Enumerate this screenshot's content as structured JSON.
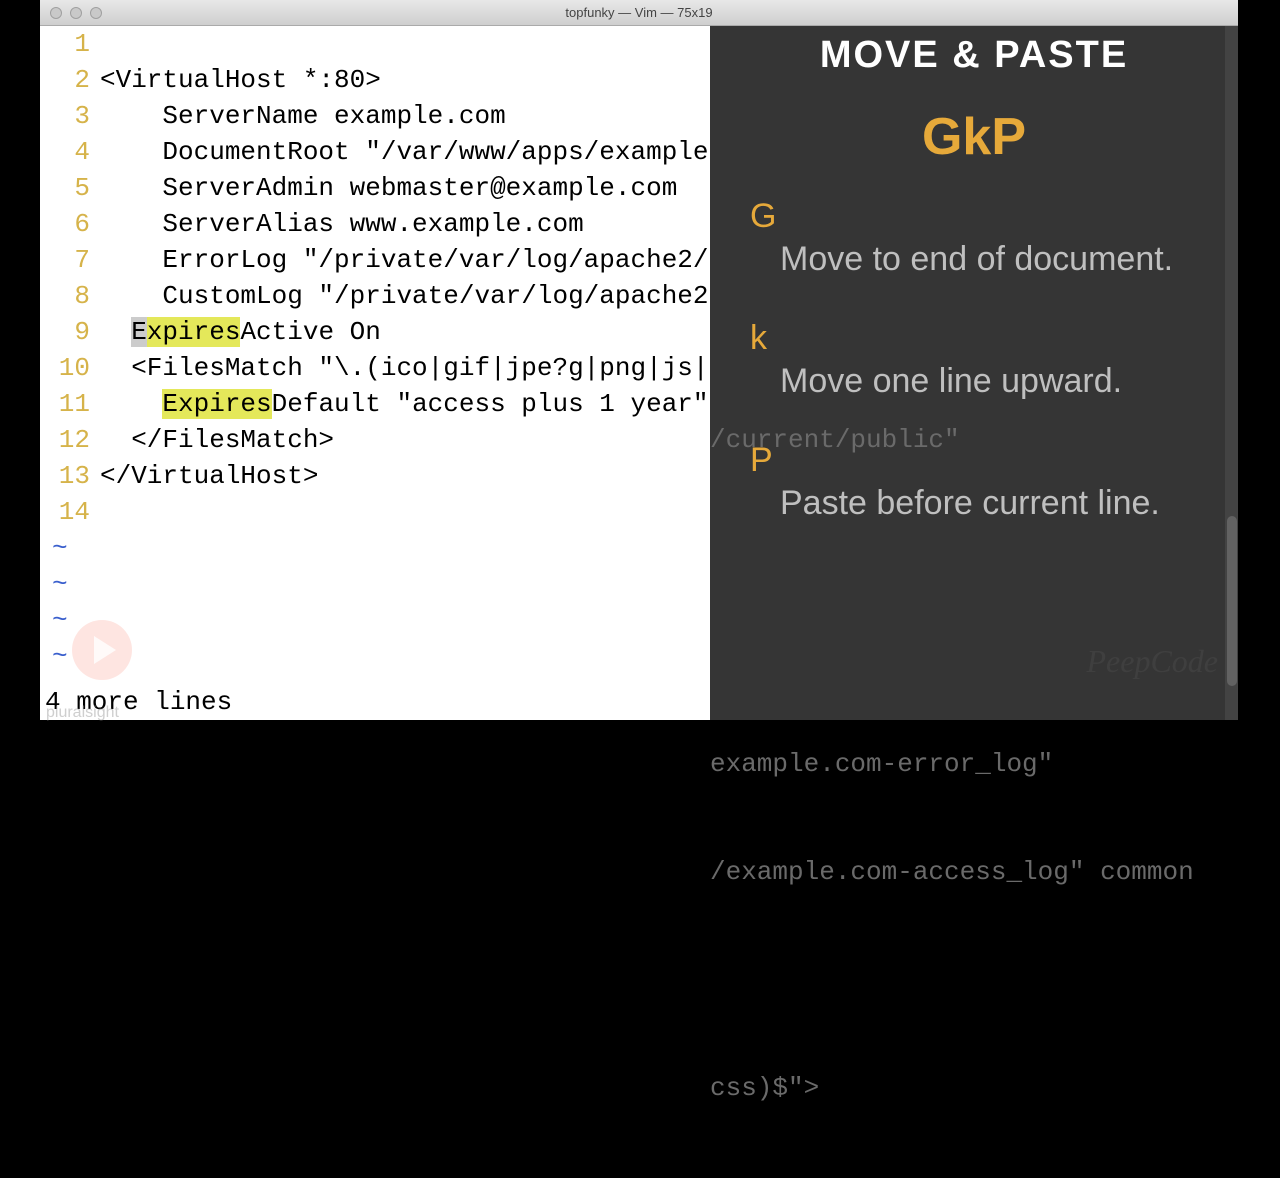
{
  "window": {
    "title": "topfunky — Vim — 75x19"
  },
  "editor": {
    "lines": [
      {
        "n": "1",
        "text": ""
      },
      {
        "n": "2",
        "text": "<VirtualHost *:80>"
      },
      {
        "n": "3",
        "text": "    ServerName example.com"
      },
      {
        "n": "4",
        "text": "    DocumentRoot \"/var/www/apps/example/current/public\""
      },
      {
        "n": "5",
        "text": "    ServerAdmin webmaster@example.com"
      },
      {
        "n": "6",
        "text": "    ServerAlias www.example.com"
      },
      {
        "n": "7",
        "text": "    ErrorLog \"/private/var/log/apache2/example.com-error_log\""
      },
      {
        "n": "8",
        "text": "    CustomLog \"/private/var/log/apache2/example.com-access_log\" common"
      },
      {
        "n": "9",
        "pre": "  ",
        "hl": "Expires",
        "post": "Active On",
        "highlight": true,
        "cursor": true
      },
      {
        "n": "10",
        "text": "  <FilesMatch \"\\.(ico|gif|jpe?g|png|js|css)$\">"
      },
      {
        "n": "11",
        "pre": "    ",
        "hl": "Expires",
        "post": "Default \"access plus 1 year\"",
        "highlight": true
      },
      {
        "n": "12",
        "text": "  </FilesMatch>"
      },
      {
        "n": "13",
        "text": "</VirtualHost>"
      },
      {
        "n": "14",
        "text": ""
      }
    ],
    "tildes": [
      "~",
      "~",
      "~",
      "~"
    ],
    "status": "4 more lines"
  },
  "overflow": {
    "r4": "/current/public\"",
    "r7": "example.com-error_log\"",
    "r8": "/example.com-access_log\" common",
    "r10": "css)$\">"
  },
  "overlay": {
    "title": "MOVE & PASTE",
    "command": "GkP",
    "items": [
      {
        "key": "G",
        "desc": "Move to end of document."
      },
      {
        "key": "k",
        "desc": "Move one line upward."
      },
      {
        "key": "P",
        "desc": "Paste before current line."
      }
    ],
    "watermark": "PeepCode",
    "brand": "pluralsight"
  }
}
